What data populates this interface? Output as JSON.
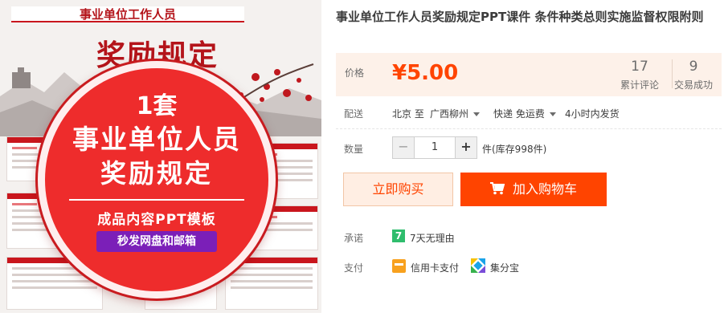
{
  "gallery": {
    "poster_header": "事业单位工作人员",
    "poster_title": "奖励规定",
    "circle": {
      "line1": "1套",
      "line2": "事业单位人员",
      "line3": "奖励规定",
      "line4": "成品内容PPT模板",
      "line5": "秒发网盘和邮箱"
    }
  },
  "product": {
    "title": "事业单位工作人员奖励规定PPT课件 条件种类总则实施监督权限附则"
  },
  "price": {
    "label": "价格",
    "value": "¥5.00",
    "reviews_count": "17",
    "reviews_label": "累计评论",
    "deals_count": "9",
    "deals_label": "交易成功"
  },
  "delivery": {
    "label": "配送",
    "from": "北京 至",
    "to": "广西柳州",
    "method": "快递 免运费",
    "time": "4小时内发货"
  },
  "quantity": {
    "label": "数量",
    "minus": "−",
    "value": "1",
    "plus": "+",
    "stock": "件(库存998件)"
  },
  "actions": {
    "buy_now": "立即购买",
    "add_to_cart": "加入购物车"
  },
  "promise": {
    "label": "承诺",
    "badge": "7",
    "text": "7天无理由"
  },
  "payment": {
    "label": "支付",
    "method1": "信用卡支付",
    "method2": "集分宝"
  },
  "colors": {
    "accent": "#ff4400",
    "price_bg": "#fdf1e9",
    "poster_red": "#ee2c2c"
  }
}
